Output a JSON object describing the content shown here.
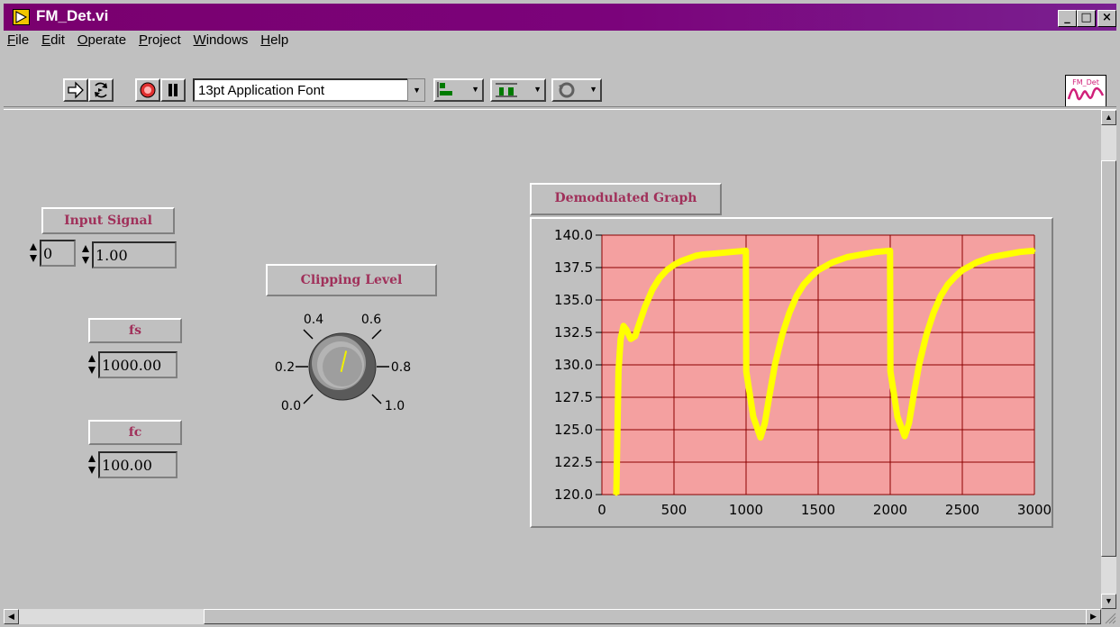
{
  "window": {
    "title": "FM_Det.vi",
    "minimize_glyph": "_",
    "restore_glyph": "□",
    "close_glyph": "×"
  },
  "menu": {
    "items": [
      {
        "label": "File",
        "underline": "F",
        "rest": "ile"
      },
      {
        "label": "Edit",
        "underline": "E",
        "rest": "dit"
      },
      {
        "label": "Operate",
        "underline": "O",
        "rest": "perate"
      },
      {
        "label": "Project",
        "underline": "P",
        "rest": "roject"
      },
      {
        "label": "Windows",
        "underline": "W",
        "rest": "indows"
      },
      {
        "label": "Help",
        "underline": "H",
        "rest": "elp"
      }
    ]
  },
  "toolbar": {
    "font_select": "13pt Application Font",
    "icons": [
      "run-arrow-icon",
      "run-continuously-icon",
      "abort-stop-icon",
      "pause-icon",
      "align-objects-icon",
      "distribute-objects-icon",
      "reorder-icon"
    ]
  },
  "vi_icon": {
    "label": "FM_Det",
    "colors": {
      "bg": "#ffffff",
      "wave": "#d0207a",
      "text": "#d0207a"
    }
  },
  "controls": {
    "input_signal": {
      "label": "Input Signal",
      "index": "0",
      "value": "1.00"
    },
    "fs": {
      "label": "fs",
      "value": "1000.00"
    },
    "fc": {
      "label": "fc",
      "value": "100.00"
    },
    "clipping_level": {
      "label": "Clipping Level",
      "ticks": [
        "0.0",
        "0.2",
        "0.4",
        "0.6",
        "0.8",
        "1.0"
      ],
      "value": 0.55
    }
  },
  "graph": {
    "label": "Demodulated Graph",
    "colors": {
      "plot_bg": "#f4a0a0",
      "grid": "#8b0000",
      "trace": "#ffff00"
    }
  },
  "chart_data": {
    "type": "line",
    "title": "Demodulated Graph",
    "xlabel": "",
    "ylabel": "",
    "xlim": [
      0,
      3000
    ],
    "ylim": [
      120.0,
      140.0
    ],
    "x_ticks": [
      "0",
      "500",
      "1000",
      "1500",
      "2000",
      "2500",
      "3000"
    ],
    "y_ticks": [
      "120.0",
      "122.5",
      "125.0",
      "127.5",
      "130.0",
      "132.5",
      "135.0",
      "137.5",
      "140.0"
    ],
    "grid": true,
    "series": [
      {
        "x": [
          100,
          115,
          130,
          150,
          170,
          200,
          230,
          260,
          300,
          350,
          400,
          450,
          500,
          550,
          600,
          650,
          700,
          800,
          900,
          999,
          1001,
          1050,
          1100,
          1130,
          1160,
          1200,
          1250,
          1300,
          1350,
          1400,
          1450,
          1500,
          1600,
          1700,
          1800,
          1900,
          1999,
          2001,
          2050,
          2100,
          2130,
          2160,
          2200,
          2250,
          2300,
          2350,
          2400,
          2450,
          2500,
          2600,
          2700,
          2800,
          2900,
          3000
        ],
        "y": [
          120.0,
          129.5,
          132.0,
          133.0,
          132.7,
          132.0,
          132.2,
          133.2,
          134.5,
          135.8,
          136.7,
          137.3,
          137.7,
          138.0,
          138.2,
          138.4,
          138.5,
          138.6,
          138.7,
          138.8,
          129.5,
          126.0,
          124.4,
          125.5,
          127.5,
          130.0,
          132.3,
          134.0,
          135.3,
          136.2,
          136.8,
          137.3,
          137.9,
          138.3,
          138.5,
          138.7,
          138.8,
          129.5,
          126.0,
          124.5,
          125.5,
          127.5,
          130.0,
          132.3,
          134.0,
          135.3,
          136.2,
          136.8,
          137.3,
          137.9,
          138.3,
          138.5,
          138.7,
          138.8
        ]
      }
    ]
  }
}
